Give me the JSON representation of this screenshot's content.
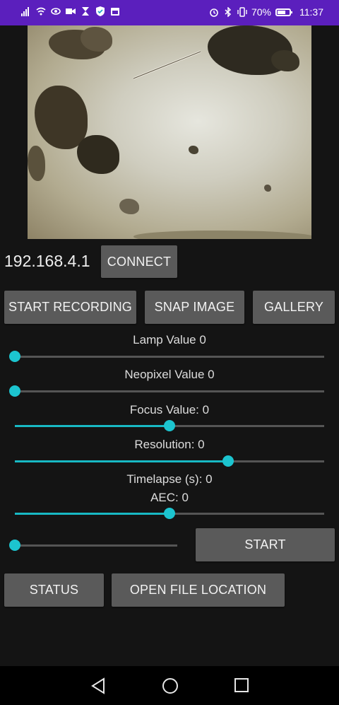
{
  "status_bar": {
    "battery_percent": "70%",
    "time": "11:37",
    "battery_level": 0.7,
    "left_icons": [
      "signal-icon",
      "wifi-icon",
      "eye-icon",
      "camera-icon",
      "hourglass-icon",
      "shield-icon",
      "calendar-icon"
    ],
    "right_icons": [
      "alarm-icon",
      "bluetooth-icon",
      "vibrate-icon",
      "battery-icon"
    ]
  },
  "ip_address": "192.168.4.1",
  "buttons": {
    "connect": "CONNECT",
    "start_recording": "START RECORDING",
    "snap_image": "SNAP IMAGE",
    "gallery": "GALLERY",
    "start": "START",
    "status": "STATUS",
    "open_file_location": "OPEN FILE LOCATION"
  },
  "sliders": {
    "lamp": {
      "label": "Lamp Value 0",
      "fraction": 0.0
    },
    "neopixel": {
      "label": "Neopixel Value 0",
      "fraction": 0.0
    },
    "focus": {
      "label": "Focus Value: 0",
      "fraction": 0.5
    },
    "resolution": {
      "label": "Resolution: 0",
      "fraction": 0.69
    },
    "timelapse": {
      "label": "Timelapse (s): 0"
    },
    "aec": {
      "label": "AEC: 0",
      "fraction": 0.5
    },
    "timelapse_slider": {
      "fraction": 0.0
    }
  },
  "colors": {
    "accent": "#1cc4cf",
    "status_bar": "#5b1fbd",
    "button": "#5a5a5a",
    "background": "#141414"
  },
  "nav": {
    "icons": [
      "back-icon",
      "home-icon",
      "recents-icon"
    ]
  }
}
